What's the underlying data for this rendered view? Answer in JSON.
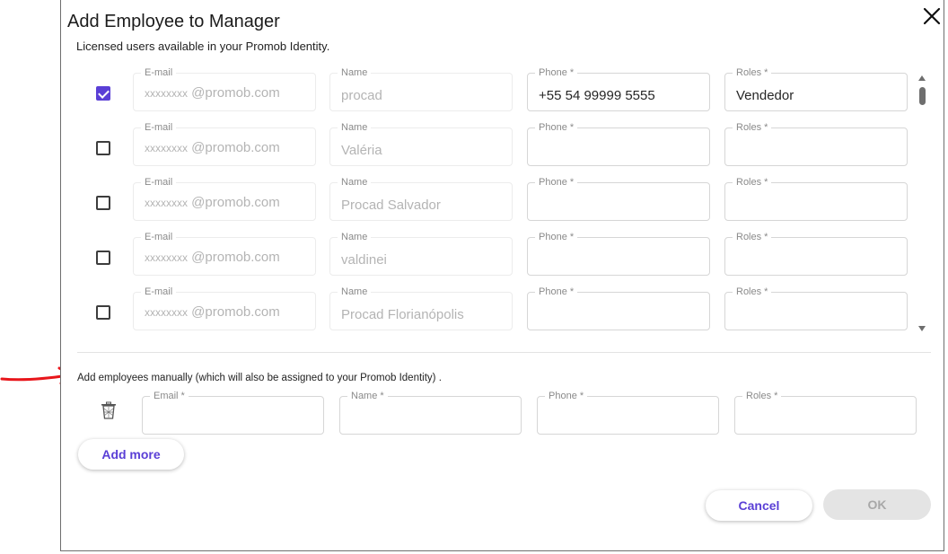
{
  "dialog": {
    "title": "Add Employee to Manager",
    "subtitle": "Licensed users available in your Promob Identity.",
    "close_icon": "close-icon"
  },
  "field_labels": {
    "email": "E-mail",
    "name": "Name",
    "phone": "Phone *",
    "roles": "Roles *"
  },
  "licensed_users": [
    {
      "checked": true,
      "email_prefix": "xxxxxxxx",
      "email_domain": " @promob.com",
      "name": "procad",
      "phone": "+55 54 99999 5555",
      "roles": "Vendedor"
    },
    {
      "checked": false,
      "email_prefix": "xxxxxxxx",
      "email_domain": " @promob.com",
      "name": "Valéria",
      "phone": "",
      "roles": ""
    },
    {
      "checked": false,
      "email_prefix": "xxxxxxxx",
      "email_domain": " @promob.com",
      "name": "Procad  Salvador",
      "phone": "",
      "roles": ""
    },
    {
      "checked": false,
      "email_prefix": "xxxxxxxx",
      "email_domain": " @promob.com",
      "name": "valdinei",
      "phone": "",
      "roles": ""
    },
    {
      "checked": false,
      "email_prefix": "xxxxxxxx",
      "email_domain": " @promob.com",
      "name": "Procad  Florianópolis",
      "phone": "",
      "roles": ""
    }
  ],
  "manual": {
    "label": "Add employees manually (which will also be assigned to your Promob Identity) .",
    "email_label": "Email *",
    "name_label": "Name *",
    "phone_label": "Phone *",
    "roles_label": "Roles *",
    "delete_icon": "trash-icon"
  },
  "buttons": {
    "add_more": "Add more",
    "cancel": "Cancel",
    "ok": "OK"
  },
  "colors": {
    "accent": "#5a3fd6",
    "annotation_arrow": "#e8161b"
  }
}
